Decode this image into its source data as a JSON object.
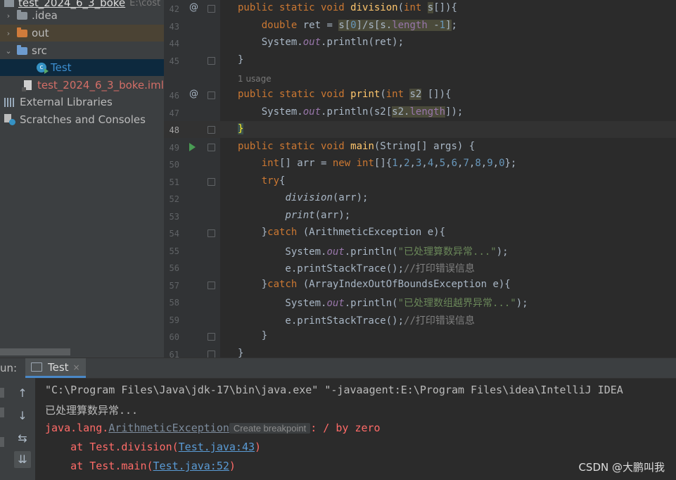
{
  "project_tree": {
    "root_label": "test_2024_6_3_boke",
    "root_path": "E:\\cost",
    "items": [
      {
        "label": "idea_folder",
        "text": ".idea",
        "chevron": "›"
      },
      {
        "label": "out_folder",
        "text": "out",
        "chevron": "›"
      },
      {
        "label": "src_folder",
        "text": "src",
        "chevron": "⌄"
      },
      {
        "label": "test_class",
        "text": "Test"
      },
      {
        "label": "iml_file",
        "text": "test_2024_6_3_boke.iml"
      },
      {
        "label": "external_libs",
        "text": "External Libraries",
        "chevron": "›"
      },
      {
        "label": "scratches",
        "text": "Scratches and Consoles"
      }
    ]
  },
  "editor": {
    "usage_hint": "1 usage",
    "line_numbers": [
      "42",
      "43",
      "44",
      "45",
      "46",
      "47",
      "48",
      "49",
      "50",
      "51",
      "52",
      "53",
      "54",
      "55",
      "56",
      "57",
      "58",
      "59",
      "60",
      "61"
    ]
  },
  "run_panel": {
    "label": "un:",
    "tab_label": "Test",
    "tab_close": "×",
    "console": {
      "cmd_line": "\"C:\\Program Files\\Java\\jdk-17\\bin\\java.exe\" \"-javaagent:E:\\Program Files\\idea\\IntelliJ IDEA",
      "output_line": "已处理算数异常...",
      "exception_prefix": "java.lang.",
      "exception_name": "ArithmeticException",
      "breakpoint_hint": "Create breakpoint",
      "exception_msg": ": / by zero",
      "trace1_prefix": "    at Test.division(",
      "trace1_link": "Test.java:43",
      "trace1_suffix": ")",
      "trace2_prefix": "    at Test.main(",
      "trace2_link": "Test.java:52",
      "trace2_suffix": ")"
    }
  },
  "watermark": "CSDN @大鹏叫我",
  "colors": {
    "keyword": "#cc7832",
    "function": "#ffc66d",
    "number": "#6897bb",
    "string": "#6a8759",
    "error": "#ff6b68",
    "link": "#5a9bd5"
  }
}
